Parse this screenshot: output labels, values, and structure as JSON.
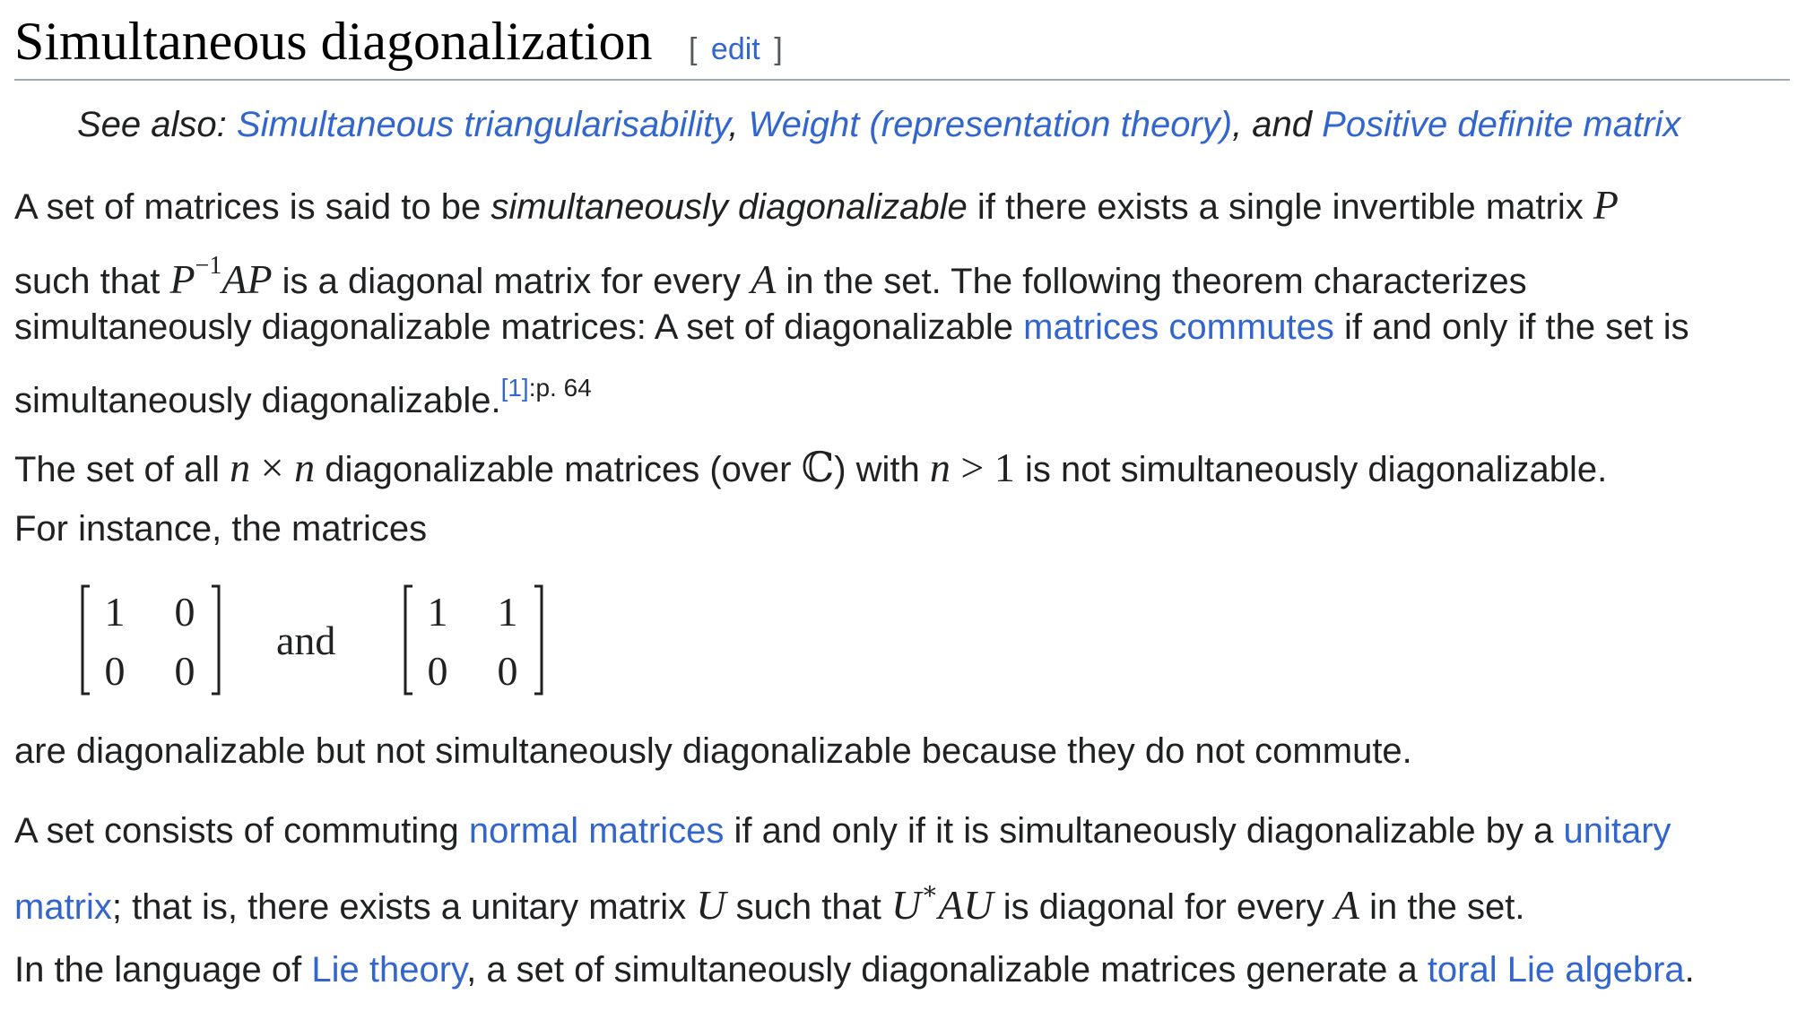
{
  "section": {
    "title": "Simultaneous diagonalization",
    "edit_open": "[",
    "edit_label": "edit",
    "edit_close": "]"
  },
  "hatnote": {
    "prefix": "See also: ",
    "link1": "Simultaneous triangularisability",
    "sep1": ", ",
    "link2": "Weight (representation theory)",
    "sep2": ", and ",
    "link3": "Positive definite matrix"
  },
  "p1": {
    "l1_a": "A set of matrices is said to be ",
    "l1_em": "simultaneously diagonalizable",
    "l1_b": " if there exists a single invertible matrix ",
    "m_P": "P",
    "l2_a": "such that ",
    "m_P2": "P",
    "m_sup": "−1",
    "m_AP": "AP",
    "l2_b": " is a diagonal matrix for every ",
    "m_A": "A",
    "l2_c": " in the set. The following theorem characterizes",
    "l3_a": "simultaneously diagonalizable matrices: A set of diagonalizable ",
    "l3_link": "matrices commutes",
    "l3_b": " if and only if the set is",
    "l4_a": "simultaneously diagonalizable.",
    "cite": "[1]",
    "cite_page": ":p. 64"
  },
  "p2": {
    "l1_a": "The set of all ",
    "m_n1": "n",
    "m_times": " × ",
    "m_n2": "n",
    "l1_b": " diagonalizable matrices (over ",
    "m_C": "ℂ",
    "l1_c": ") with ",
    "m_n3": "n",
    "m_gt": " > 1",
    "l1_d": " is not simultaneously diagonalizable.",
    "l2": "For instance, the matrices"
  },
  "matrices": {
    "m1": [
      "1",
      "0",
      "0",
      "0"
    ],
    "and": "and",
    "m2": [
      "1",
      "1",
      "0",
      "0"
    ]
  },
  "p3": {
    "text": "are diagonalizable but not simultaneously diagonalizable because they do not commute."
  },
  "p4": {
    "l1_a": "A set consists of commuting ",
    "l1_link": "normal matrices",
    "l1_b": " if and only if it is simultaneously diagonalizable by a ",
    "l1_link2": "unitary",
    "l2_link": "matrix",
    "l2_a": "; that is, there exists a unitary matrix ",
    "m_U": "U",
    "l2_b": " such that ",
    "m_U2": "U",
    "m_star": "∗",
    "m_AU": "AU",
    "l2_c": " is diagonal for every ",
    "m_A": "A",
    "l2_d": " in the set."
  },
  "p5": {
    "a": "In the language of ",
    "link1": "Lie theory",
    "b": ", a set of simultaneously diagonalizable matrices generate a ",
    "link2": "toral Lie algebra",
    "c": "."
  },
  "colors": {
    "text": "#202122",
    "link": "#3366cc",
    "rule": "#a2a9b1"
  }
}
